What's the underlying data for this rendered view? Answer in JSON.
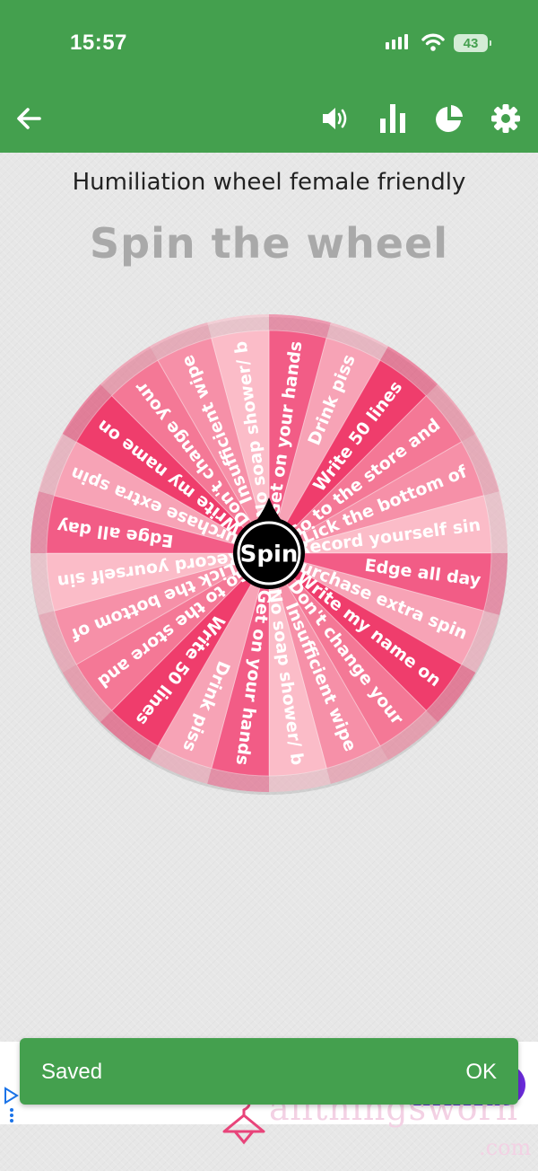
{
  "status_bar": {
    "time": "15:57",
    "battery": "43"
  },
  "toolbar": {
    "back_icon": "arrow-left-icon",
    "sound_icon": "speaker-icon",
    "stats_icon": "bar-chart-icon",
    "pie_icon": "pie-chart-icon",
    "settings_icon": "gear-icon"
  },
  "wheel": {
    "title": "Humiliation wheel female friendly",
    "heading": "Spin the wheel",
    "spin_label": "Spin",
    "segments": [
      "Get on your hands",
      "Drink piss",
      "Write 50 lines",
      "Go to the store and",
      "Lick the bottom of",
      "Record yourself sin",
      "Edge all day",
      "Purchase extra spin",
      "Write my name on",
      "Don't change your",
      "Insufficient wipe",
      "No soap shower/ b",
      "Get on your hands",
      "Drink piss",
      "Write 50 lines",
      "Go to the store and",
      "Lick the bottom of",
      "Record yourself sin",
      "Edge all day",
      "Purchase extra spin",
      "Write my name on",
      "Don't change your",
      "Insufficient wipe",
      "No soap shower/ b"
    ],
    "colors": [
      "#f25c86",
      "#f7a3b6",
      "#ef3d6c",
      "#f47896",
      "#f690a8",
      "#fbbcc8"
    ]
  },
  "ad": {
    "brand": "allthingsworn",
    "brand_sub": ".com"
  },
  "snackbar": {
    "message": "Saved",
    "action": "OK"
  }
}
